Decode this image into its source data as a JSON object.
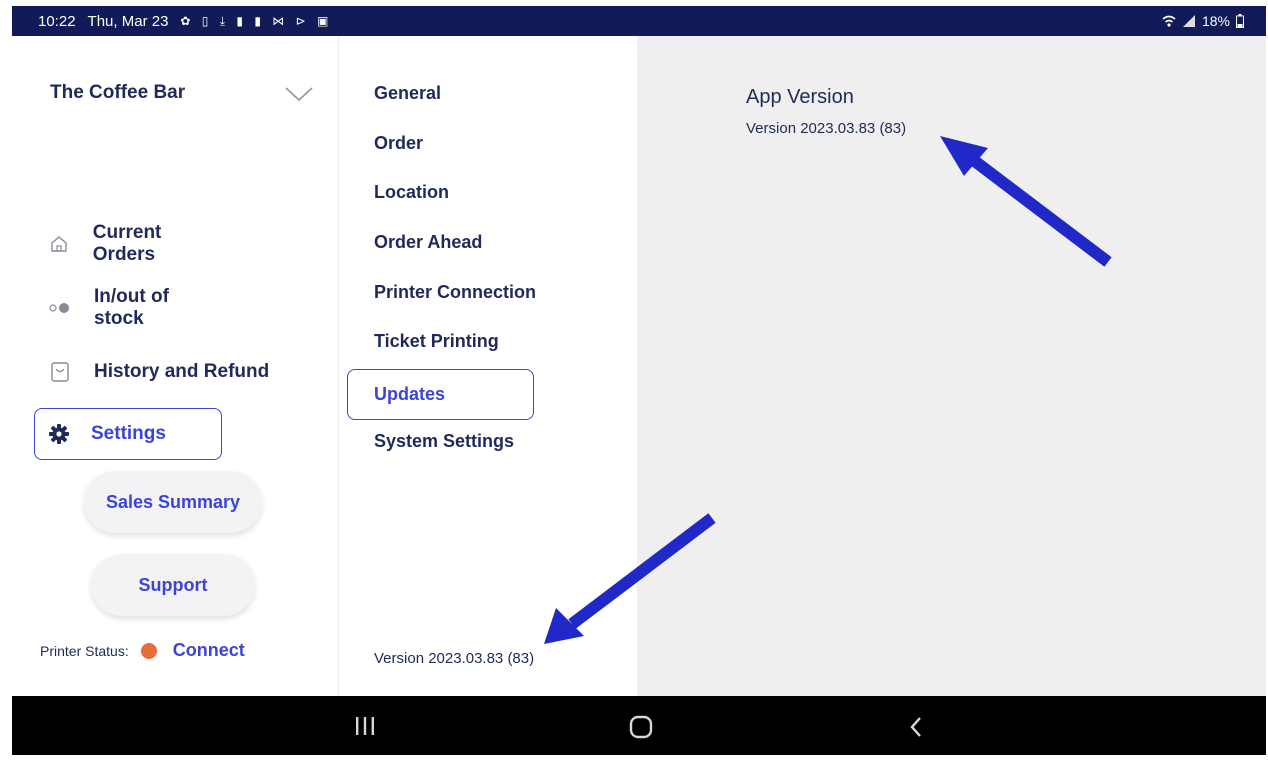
{
  "status_bar": {
    "time": "10:22",
    "date": "Thu, Mar 23",
    "notification_icons": "✿ ▯ ⤓ ▮ ▮ ⋈ ⊳ ▣",
    "battery": "18%"
  },
  "store": {
    "name": "The Coffee Bar",
    "chevron_icon": "chevron-down-icon"
  },
  "nav": {
    "items": [
      {
        "label": "Current Orders",
        "icon": "home-icon"
      },
      {
        "label": "In/out of stock",
        "icon": "toggle-icon"
      },
      {
        "label": "History and Refund",
        "icon": "bag-icon"
      },
      {
        "label": "Settings",
        "icon": "gear-icon",
        "active": true
      }
    ],
    "pills": [
      "Sales Summary",
      "Support"
    ]
  },
  "printer": {
    "label": "Printer Status:",
    "status_color": "#ea6b3a",
    "action": "Connect"
  },
  "settings_menu": {
    "items": [
      "General",
      "Order",
      "Location",
      "Order Ahead",
      "Printer Connection",
      "Ticket Printing",
      "Updates",
      "System Settings"
    ],
    "selected": "Updates",
    "footer_version": "Version 2023.03.83 (83)"
  },
  "detail": {
    "title": "App Version",
    "version": "Version 2023.03.83 (83)"
  },
  "colors": {
    "accent": "#3c43d8",
    "status_bar": "#121a57",
    "text": "#1f2a5a",
    "pane_bg": "#efeff0",
    "annotation_arrow": "#2128c8"
  }
}
